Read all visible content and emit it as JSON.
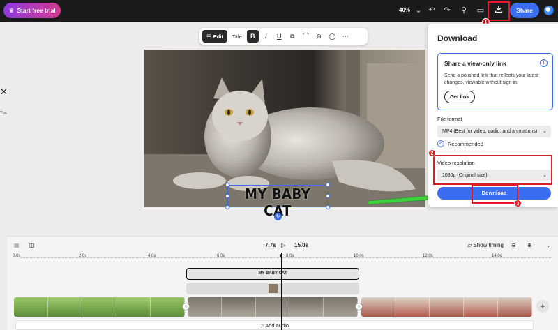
{
  "topbar": {
    "trial_label": "Start free trial",
    "zoom": "40%",
    "share_label": "Share",
    "icons": [
      "crown-icon",
      "chevron-down-icon",
      "undo-icon",
      "redo-icon",
      "accessibility-icon",
      "comment-icon",
      "download-icon",
      "avatar"
    ]
  },
  "toolbar": {
    "edit_label": "Edit",
    "title_label": "Title",
    "buttons": [
      "bold-icon",
      "italic-icon",
      "underline-icon",
      "copy-style-icon",
      "paint-icon",
      "lock-icon",
      "comment-icon",
      "more-icon"
    ]
  },
  "left_strip": {
    "label": "Tus"
  },
  "canvas": {
    "caption": "MY BABY CAT"
  },
  "download_panel": {
    "title": "Download",
    "share_card": {
      "title": "Share a view-only link",
      "description": "Send a polished link that reflects your latest changes, viewable without sign in.",
      "get_link": "Get link"
    },
    "file_format_label": "File format",
    "file_format_value": "MP4 (Best for video, audio, and animations)",
    "recommended": "Recommended",
    "video_resolution_label": "Video resolution",
    "video_resolution_value": "1080p (Original size)",
    "download_label": "Download"
  },
  "annotations": {
    "step1": "1",
    "step2": "2",
    "step3": "3"
  },
  "timeline": {
    "current_time": "7.7s",
    "total_time": "15.0s",
    "show_timing": "Show timing",
    "ruler": [
      "0.0s",
      "2.0s",
      "4.0s",
      "6.0s",
      "8.0s",
      "10.0s",
      "12.0s",
      "14.0s"
    ],
    "text_track": "MY BABY CAT",
    "add_audio": "Add audio"
  },
  "colors": {
    "accent": "#3a6df0",
    "annotation": "#e01b24",
    "arrow": "#3fd03f"
  }
}
